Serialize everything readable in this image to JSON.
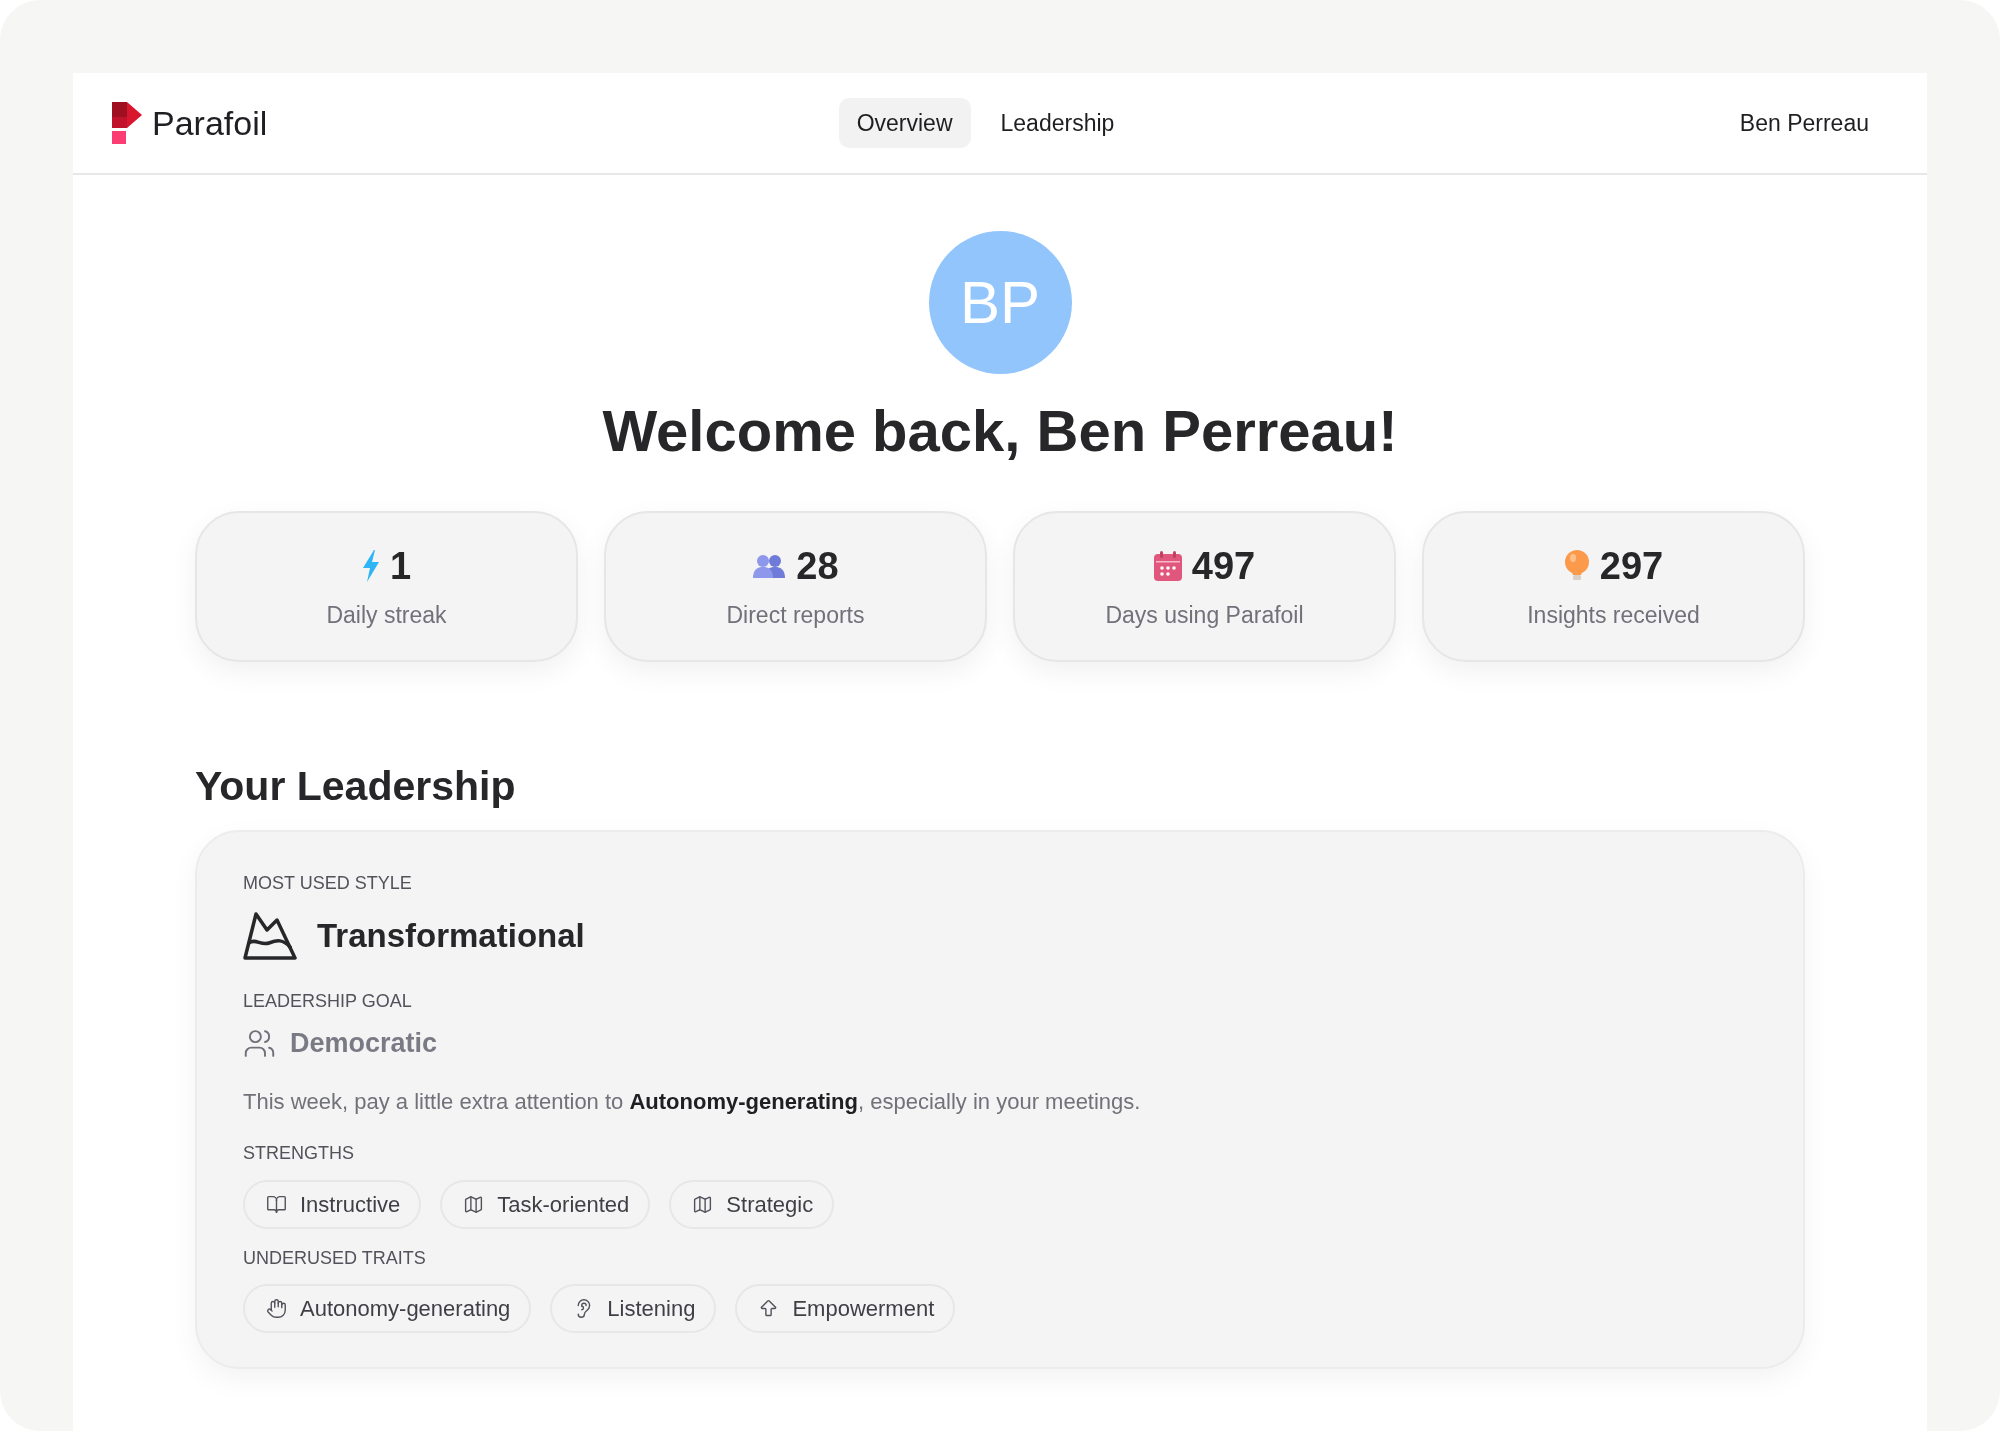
{
  "brand": {
    "name": "Parafoil"
  },
  "nav": {
    "tabs": [
      {
        "label": "Overview",
        "selected": true
      },
      {
        "label": "Leadership",
        "selected": false
      }
    ]
  },
  "user": {
    "name": "Ben Perreau"
  },
  "profile": {
    "initials": "BP",
    "greeting": "Welcome back, Ben Perreau!"
  },
  "stats": [
    {
      "kind": "streak",
      "value": "1",
      "label": "Daily streak"
    },
    {
      "kind": "reports",
      "value": "28",
      "label": "Direct reports"
    },
    {
      "kind": "days",
      "value": "497",
      "label": "Days using Parafoil"
    },
    {
      "kind": "insights",
      "value": "297",
      "label": "Insights received"
    }
  ],
  "leadership": {
    "heading": "Your Leadership",
    "most_used_style": {
      "label": "MOST USED STYLE",
      "value": "Transformational"
    },
    "goal": {
      "label": "LEADERSHIP GOAL",
      "value": "Democratic"
    },
    "advice": "This week, pay a little extra attention to **Autonomy-generating**, especially in your meetings.",
    "strengths": {
      "label": "STRENGTHS",
      "items": [
        "Instructive",
        "Task-oriented",
        "Strategic"
      ]
    },
    "underused_traits": {
      "label": "UNDERUSED TRAITS",
      "items": [
        "Autonomy-generating",
        "Listening",
        "Empowerment"
      ]
    }
  }
}
